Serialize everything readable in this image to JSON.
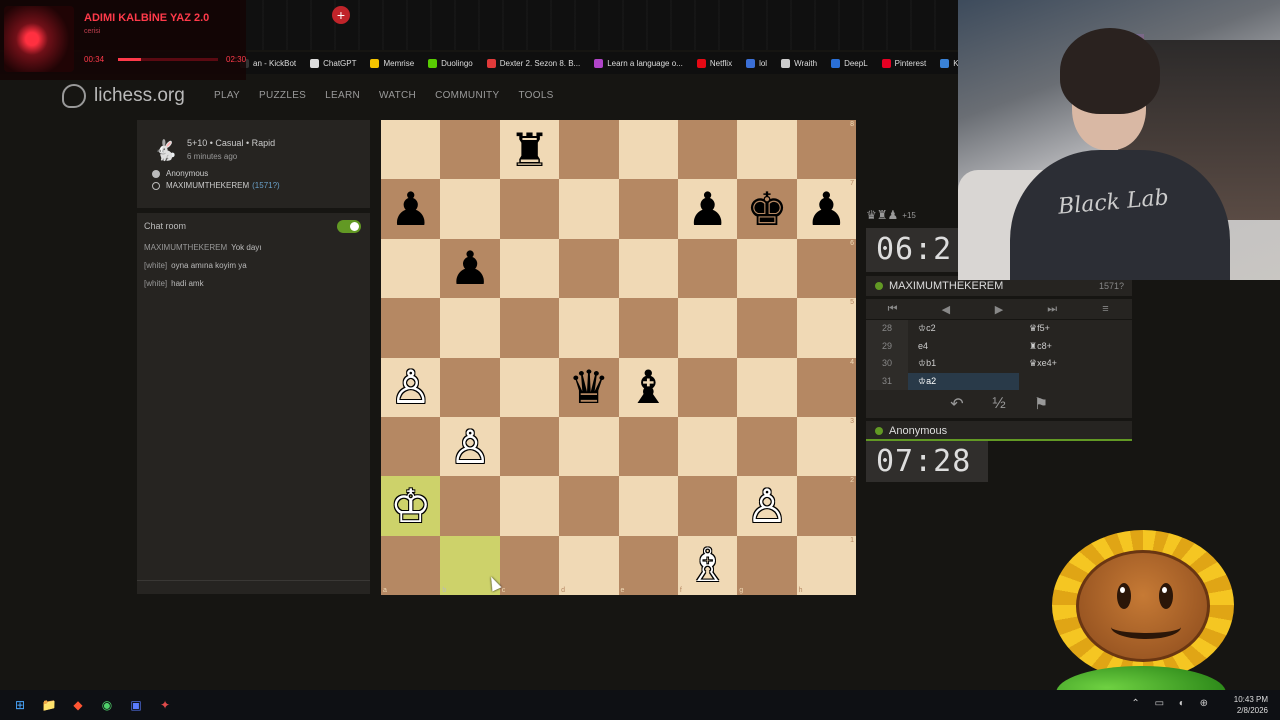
{
  "browser": {
    "new_tab_icon": "plus-icon",
    "bookmarks": [
      {
        "label": "an - KickBot",
        "icon_color": "#333333"
      },
      {
        "label": "ChatGPT",
        "icon_color": "#dddddd"
      },
      {
        "label": "Memrise",
        "icon_color": "#f5c400"
      },
      {
        "label": "Duolingo",
        "icon_color": "#58cc02"
      },
      {
        "label": "Dexter 2. Sezon 8. B...",
        "icon_color": "#e03a3a"
      },
      {
        "label": "Learn a language o...",
        "icon_color": "#b044c8"
      },
      {
        "label": "Netflix",
        "icon_color": "#e50914"
      },
      {
        "label": "lol",
        "icon_color": "#3b6fd6"
      },
      {
        "label": "Wraith",
        "icon_color": "#cccccc"
      },
      {
        "label": "DeepL",
        "icon_color": "#2a6fd6"
      },
      {
        "label": "Pinterest",
        "icon_color": "#e60023"
      },
      {
        "label": "Kahve Ku",
        "icon_color": "#3a82d6"
      }
    ]
  },
  "now_playing": {
    "title": "ADIMI KALBİNE YAZ 2.0",
    "artist": "cerisi",
    "elapsed": "00:34",
    "duration": "02:30",
    "progress": 0.23
  },
  "site": {
    "name": "lichess.org",
    "nav": [
      "PLAY",
      "PUZZLES",
      "LEARN",
      "WATCH",
      "COMMUNITY",
      "TOOLS"
    ]
  },
  "game": {
    "mode": "5+10 • Casual • Rapid",
    "started": "6 minutes ago",
    "white_player": "Anonymous",
    "black_player": "MAXIMUMTHEKEREM",
    "black_rating": "(1571?)"
  },
  "chat": {
    "title": "Chat room",
    "enabled": true,
    "messages": [
      {
        "user": "MAXIMUMTHEKEREM",
        "text": "Yok dayı"
      },
      {
        "user": "[white]",
        "text": "oyna amına koyim ya"
      },
      {
        "user": "[white]",
        "text": "hadi amk"
      }
    ]
  },
  "board": {
    "orientation": "white",
    "ranks": [
      "8",
      "7",
      "6",
      "5",
      "4",
      "3",
      "2",
      "1"
    ],
    "files": [
      "a",
      "b",
      "c",
      "d",
      "e",
      "f",
      "g",
      "h"
    ],
    "position": [
      [
        "",
        "",
        "♜",
        "",
        "",
        "",
        "",
        ""
      ],
      [
        "♟",
        "",
        "",
        "",
        "",
        "♟",
        "♚",
        "♟"
      ],
      [
        "",
        "♟",
        "",
        "",
        "",
        "",
        "",
        ""
      ],
      [
        "",
        "",
        "",
        "",
        "",
        "",
        "",
        ""
      ],
      [
        "♙",
        "",
        "",
        "♛",
        "♝",
        "",
        "",
        ""
      ],
      [
        "",
        "♙",
        "",
        "",
        "",
        "",
        "",
        ""
      ],
      [
        "♔",
        "",
        "",
        "",
        "",
        "",
        "♙",
        ""
      ],
      [
        "",
        "",
        "",
        "",
        "",
        "♗",
        "",
        ""
      ]
    ],
    "highlighted": [
      "a2",
      "b1"
    ]
  },
  "top_player": {
    "material": "♛♜♟",
    "advantage": "+15",
    "clock": "06:2",
    "name": "MAXIMUMTHEKEREM",
    "rating": "1571?"
  },
  "bottom_player": {
    "name": "Anonymous",
    "clock": "07:28"
  },
  "controls": [
    "⏮",
    "◀",
    "▶",
    "⏭",
    "≡"
  ],
  "moves": [
    {
      "n": "28",
      "white": "♔c2",
      "black": "♛f5+"
    },
    {
      "n": "29",
      "white": "e4",
      "black": "♜c8+"
    },
    {
      "n": "30",
      "white": "♔b1",
      "black": "♛xe4+"
    },
    {
      "n": "31",
      "white": "♔a2",
      "black": ""
    }
  ],
  "actions": [
    "↶",
    "½",
    "⚑"
  ],
  "webcam": {
    "shirt_text": "Black Lab"
  },
  "taskbar": {
    "icons": [
      "⊞",
      "📁",
      "◆",
      "◉",
      "▣",
      "✦"
    ],
    "time": "10:43 PM",
    "date": "2/8/2026"
  }
}
